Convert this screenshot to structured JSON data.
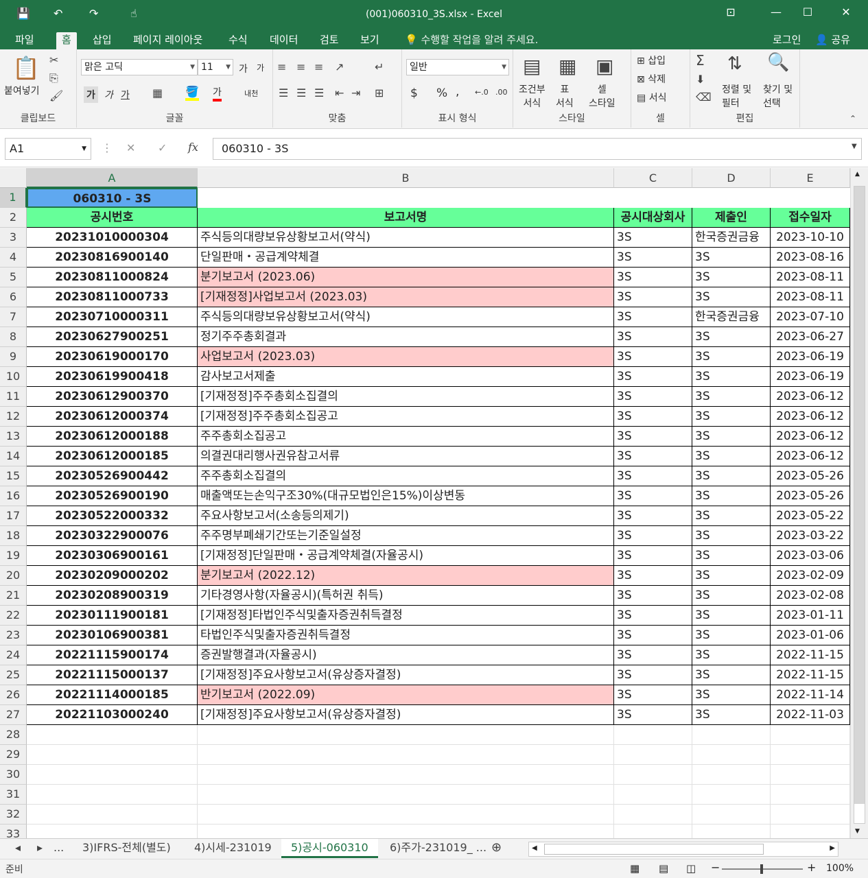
{
  "window": {
    "title": "(001)060310_3S.xlsx  -  Excel",
    "minimize": "—",
    "restore": "☐",
    "close": "✕",
    "ribbon_display": "⊡"
  },
  "quick_access": {
    "save": "💾",
    "undo": "↶",
    "redo": "↷",
    "touch": "☝"
  },
  "ribbon_tabs": [
    {
      "label": "파일"
    },
    {
      "label": "홈"
    },
    {
      "label": "삽입"
    },
    {
      "label": "페이지 레이아웃"
    },
    {
      "label": "수식"
    },
    {
      "label": "데이터"
    },
    {
      "label": "검토"
    },
    {
      "label": "보기"
    }
  ],
  "tell_me": "수행할 작업을 알려 주세요.",
  "account": {
    "login": "로그인",
    "share": "공유"
  },
  "ribbon": {
    "clipboard": {
      "paste": "붙여넣기",
      "label": "클립보드"
    },
    "font": {
      "name": "맑은 고딕",
      "size": "11",
      "bold": "가",
      "italic": "가",
      "underline": "가",
      "grow": "가",
      "shrink": "가",
      "phonetic": "내천",
      "label": "글꼴"
    },
    "align": {
      "label": "맞춤"
    },
    "number": {
      "format": "일반",
      "currency": "$",
      "percent": "%",
      "comma": ",",
      "inc": "←.0",
      "dec": ".00",
      "label": "표시 형식"
    },
    "styles": {
      "cond": "조건부\n서식",
      "table": "표\n서식",
      "cell": "셀\n스타일",
      "cond1": "조건부",
      "cond2": "서식",
      "table1": "표",
      "table2": "서식",
      "cell1": "셀",
      "cell2": "스타일",
      "label": "스타일"
    },
    "cells": {
      "insert": "삽입",
      "delete": "삭제",
      "format": "서식",
      "label": "셀"
    },
    "editing": {
      "sort1": "정렬 및",
      "sort2": "필터",
      "find1": "찾기 및",
      "find2": "선택",
      "label": "편집"
    }
  },
  "formula_bar": {
    "name_box": "A1",
    "content": "060310 - 3S",
    "cancel": "✕",
    "enter": "✓",
    "fx": "fx"
  },
  "columns": [
    "A",
    "B",
    "C",
    "D",
    "E"
  ],
  "row_numbers": [
    "1",
    "2",
    "3",
    "4",
    "5",
    "6",
    "7",
    "8",
    "9",
    "10",
    "11",
    "12",
    "13",
    "14",
    "15",
    "16",
    "17",
    "18",
    "19",
    "20",
    "21",
    "22",
    "23",
    "24",
    "25",
    "26",
    "27",
    "28",
    "29",
    "30",
    "31",
    "32",
    "33"
  ],
  "a1": "060310 - 3S",
  "headers": [
    "공시번호",
    "보고서명",
    "공시대상회사",
    "제출인",
    "접수일자"
  ],
  "rows": [
    {
      "no": "20231010000304",
      "name": "주식등의대량보유상황보고서(약식)",
      "corp": "3S",
      "sub": "한국증권금융",
      "date": "2023-10-10",
      "hl": false
    },
    {
      "no": "20230816900140",
      "name": "단일판매・공급계약체결",
      "corp": "3S",
      "sub": "3S",
      "date": "2023-08-16",
      "hl": false
    },
    {
      "no": "20230811000824",
      "name": "분기보고서 (2023.06)",
      "corp": "3S",
      "sub": "3S",
      "date": "2023-08-11",
      "hl": true
    },
    {
      "no": "20230811000733",
      "name": "[기재정정]사업보고서 (2023.03)",
      "corp": "3S",
      "sub": "3S",
      "date": "2023-08-11",
      "hl": true
    },
    {
      "no": "20230710000311",
      "name": "주식등의대량보유상황보고서(약식)",
      "corp": "3S",
      "sub": "한국증권금융",
      "date": "2023-07-10",
      "hl": false
    },
    {
      "no": "20230627900251",
      "name": "정기주주총회결과",
      "corp": "3S",
      "sub": "3S",
      "date": "2023-06-27",
      "hl": false
    },
    {
      "no": "20230619000170",
      "name": "사업보고서 (2023.03)",
      "corp": "3S",
      "sub": "3S",
      "date": "2023-06-19",
      "hl": true
    },
    {
      "no": "20230619900418",
      "name": "감사보고서제출",
      "corp": "3S",
      "sub": "3S",
      "date": "2023-06-19",
      "hl": false
    },
    {
      "no": "20230612900370",
      "name": "[기재정정]주주총회소집결의",
      "corp": "3S",
      "sub": "3S",
      "date": "2023-06-12",
      "hl": false
    },
    {
      "no": "20230612000374",
      "name": "[기재정정]주주총회소집공고",
      "corp": "3S",
      "sub": "3S",
      "date": "2023-06-12",
      "hl": false
    },
    {
      "no": "20230612000188",
      "name": "주주총회소집공고",
      "corp": "3S",
      "sub": "3S",
      "date": "2023-06-12",
      "hl": false
    },
    {
      "no": "20230612000185",
      "name": "의결권대리행사권유참고서류",
      "corp": "3S",
      "sub": "3S",
      "date": "2023-06-12",
      "hl": false
    },
    {
      "no": "20230526900442",
      "name": "주주총회소집결의",
      "corp": "3S",
      "sub": "3S",
      "date": "2023-05-26",
      "hl": false
    },
    {
      "no": "20230526900190",
      "name": "매출액또는손익구조30%(대규모법인은15%)이상변동",
      "corp": "3S",
      "sub": "3S",
      "date": "2023-05-26",
      "hl": false
    },
    {
      "no": "20230522000332",
      "name": "주요사항보고서(소송등의제기)",
      "corp": "3S",
      "sub": "3S",
      "date": "2023-05-22",
      "hl": false
    },
    {
      "no": "20230322900076",
      "name": "주주명부폐쇄기간또는기준일설정",
      "corp": "3S",
      "sub": "3S",
      "date": "2023-03-22",
      "hl": false
    },
    {
      "no": "20230306900161",
      "name": "[기재정정]단일판매・공급계약체결(자율공시)",
      "corp": "3S",
      "sub": "3S",
      "date": "2023-03-06",
      "hl": false
    },
    {
      "no": "20230209000202",
      "name": "분기보고서 (2022.12)",
      "corp": "3S",
      "sub": "3S",
      "date": "2023-02-09",
      "hl": true
    },
    {
      "no": "20230208900319",
      "name": "기타경영사항(자율공시)(특허권 취득)",
      "corp": "3S",
      "sub": "3S",
      "date": "2023-02-08",
      "hl": false
    },
    {
      "no": "20230111900181",
      "name": "[기재정정]타법인주식및출자증권취득결정",
      "corp": "3S",
      "sub": "3S",
      "date": "2023-01-11",
      "hl": false
    },
    {
      "no": "20230106900381",
      "name": "타법인주식및출자증권취득결정",
      "corp": "3S",
      "sub": "3S",
      "date": "2023-01-06",
      "hl": false
    },
    {
      "no": "20221115900174",
      "name": "증권발행결과(자율공시)",
      "corp": "3S",
      "sub": "3S",
      "date": "2022-11-15",
      "hl": false
    },
    {
      "no": "20221115000137",
      "name": "[기재정정]주요사항보고서(유상증자결정)",
      "corp": "3S",
      "sub": "3S",
      "date": "2022-11-15",
      "hl": false
    },
    {
      "no": "20221114000185",
      "name": "반기보고서 (2022.09)",
      "corp": "3S",
      "sub": "3S",
      "date": "2022-11-14",
      "hl": true
    },
    {
      "no": "20221103000240",
      "name": "[기재정정]주요사항보고서(유상증자결정)",
      "corp": "3S",
      "sub": "3S",
      "date": "2022-11-03",
      "hl": false
    }
  ],
  "sheet_tabs": [
    {
      "label": "3)IFRS-전체(별도)",
      "active": false
    },
    {
      "label": "4)시세-231019",
      "active": false
    },
    {
      "label": "5)공시-060310",
      "active": true
    },
    {
      "label": "6)주가-231019_ ...",
      "active": false
    }
  ],
  "sheet_nav": {
    "prev": "◂",
    "next": "▸",
    "more": "...",
    "add": "⊕"
  },
  "status": {
    "ready": "준비",
    "zoom": "100%",
    "minus": "−",
    "plus": "+"
  },
  "colors": {
    "excel_green": "#217346",
    "header_fill": "#66ff99",
    "a1_fill": "#5fa8f0",
    "highlight": "#ffcccc"
  }
}
